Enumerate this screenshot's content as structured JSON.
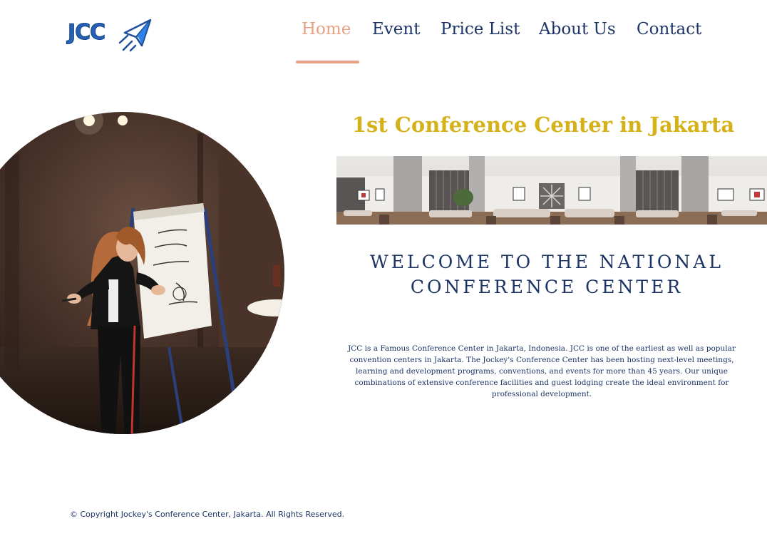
{
  "brand": {
    "logo_text": "JCC",
    "logo_icon": "paper-plane-icon"
  },
  "nav": {
    "items": [
      {
        "label": "Home",
        "active": true
      },
      {
        "label": "Event",
        "active": false
      },
      {
        "label": "Price List",
        "active": false
      },
      {
        "label": "About Us",
        "active": false
      },
      {
        "label": "Contact",
        "active": false
      }
    ]
  },
  "hero": {
    "headline": "1st Conference Center in Jakarta",
    "welcome_line1": "WELCOME TO THE NATIONAL",
    "welcome_line2": "CONFERENCE CENTER",
    "intro": "JCC is a Famous Conference Center in Jakarta, Indonesia. JCC is one of the earliest as well as popular convention centers in Jakarta. The Jockey's Conference Center has been hosting next-level meetings, learning and development programs, conventions, and events for more than 45 years. Our unique combinations of extensive conference facilities and guest lodging create the ideal environment for professional development."
  },
  "footer": {
    "copyright": "© Copyright Jockey's Conference Center, Jakarta. All Rights Reserved."
  },
  "colors": {
    "nav_text": "#1c3466",
    "nav_active": "#e8a184",
    "headline": "#d6b21a",
    "logo": "#2461b7"
  }
}
